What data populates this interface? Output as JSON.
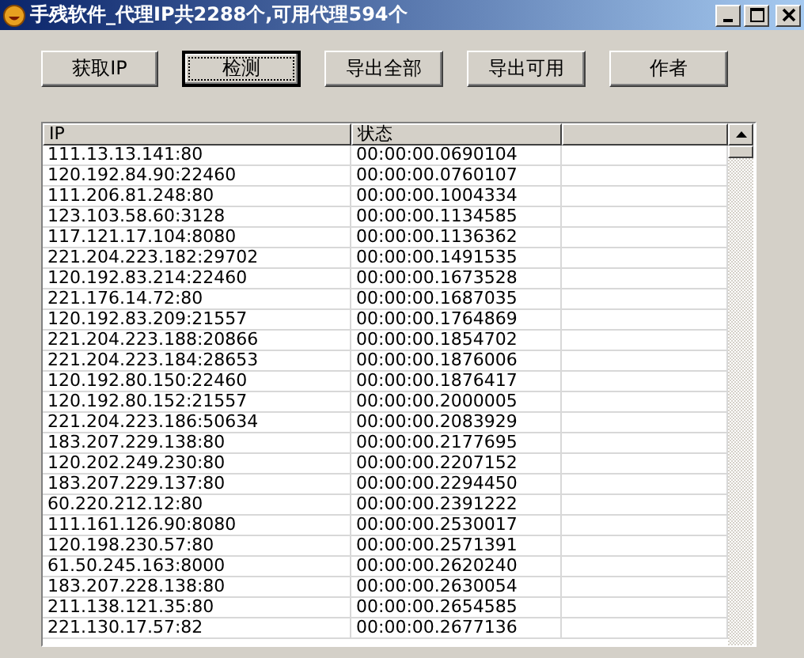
{
  "window": {
    "title": "手残软件_代理IP共2288个,可用代理594个"
  },
  "buttons": [
    {
      "label": "获取IP",
      "focused": false
    },
    {
      "label": "检测",
      "focused": true
    },
    {
      "label": "导出全部",
      "focused": false
    },
    {
      "label": "导出可用",
      "focused": false
    },
    {
      "label": "作者",
      "focused": false
    }
  ],
  "table": {
    "columns": [
      "IP",
      "状态"
    ],
    "rows": [
      [
        "111.13.13.141:80",
        "00:00:00.0690104"
      ],
      [
        "120.192.84.90:22460",
        "00:00:00.0760107"
      ],
      [
        "111.206.81.248:80",
        "00:00:00.1004334"
      ],
      [
        "123.103.58.60:3128",
        "00:00:00.1134585"
      ],
      [
        "117.121.17.104:8080",
        "00:00:00.1136362"
      ],
      [
        "221.204.223.182:29702",
        "00:00:00.1491535"
      ],
      [
        "120.192.83.214:22460",
        "00:00:00.1673528"
      ],
      [
        "221.176.14.72:80",
        "00:00:00.1687035"
      ],
      [
        "120.192.83.209:21557",
        "00:00:00.1764869"
      ],
      [
        "221.204.223.188:20866",
        "00:00:00.1854702"
      ],
      [
        "221.204.223.184:28653",
        "00:00:00.1876006"
      ],
      [
        "120.192.80.150:22460",
        "00:00:00.1876417"
      ],
      [
        "120.192.80.152:21557",
        "00:00:00.2000005"
      ],
      [
        "221.204.223.186:50634",
        "00:00:00.2083929"
      ],
      [
        "183.207.229.138:80",
        "00:00:00.2177695"
      ],
      [
        "120.202.249.230:80",
        "00:00:00.2207152"
      ],
      [
        "183.207.229.137:80",
        "00:00:00.2294450"
      ],
      [
        "60.220.212.12:80",
        "00:00:00.2391222"
      ],
      [
        "111.161.126.90:8080",
        "00:00:00.2530017"
      ],
      [
        "120.198.230.57:80",
        "00:00:00.2571391"
      ],
      [
        "61.50.245.163:8000",
        "00:00:00.2620240"
      ],
      [
        "183.207.228.138:80",
        "00:00:00.2630054"
      ],
      [
        "211.138.121.35:80",
        "00:00:00.2654585"
      ],
      [
        "221.130.17.57:82",
        "00:00:00.2677136"
      ]
    ]
  }
}
